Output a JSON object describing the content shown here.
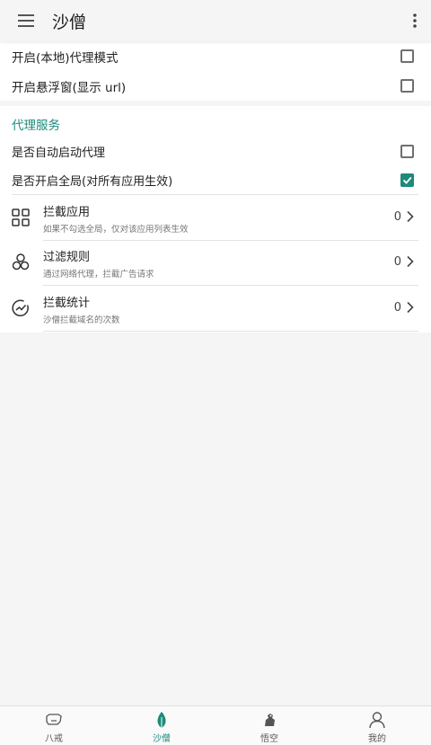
{
  "appbar": {
    "title": "沙僧"
  },
  "top_settings": [
    {
      "label": "开启(本地)代理模式",
      "checked": false
    },
    {
      "label": "开启悬浮窗(显示 url)",
      "checked": false
    }
  ],
  "proxy_section": {
    "title": "代理服务",
    "options": [
      {
        "label": "是否自动启动代理",
        "checked": false
      },
      {
        "label": "是否开启全局(对所有应用生效)",
        "checked": true
      }
    ],
    "items": [
      {
        "title": "拦截应用",
        "subtitle": "如果不勾选全局，仅对该应用列表生效",
        "count": "0",
        "icon": "grid-icon"
      },
      {
        "title": "过滤规则",
        "subtitle": "通过网络代理，拦截广告请求",
        "count": "0",
        "icon": "hexagon-cluster-icon"
      },
      {
        "title": "拦截统计",
        "subtitle": "沙僧拦截域名的次数",
        "count": "0",
        "icon": "chart-circle-icon"
      }
    ]
  },
  "bottom_nav": [
    {
      "label": "八戒",
      "icon": "pig-icon",
      "active": false
    },
    {
      "label": "沙僧",
      "icon": "leaf-icon",
      "active": true
    },
    {
      "label": "悟空",
      "icon": "monkey-icon",
      "active": false
    },
    {
      "label": "我的",
      "icon": "person-icon",
      "active": false
    }
  ],
  "colors": {
    "accent": "#1d8a7a",
    "background": "#f5f5f5",
    "card": "#ffffff"
  }
}
